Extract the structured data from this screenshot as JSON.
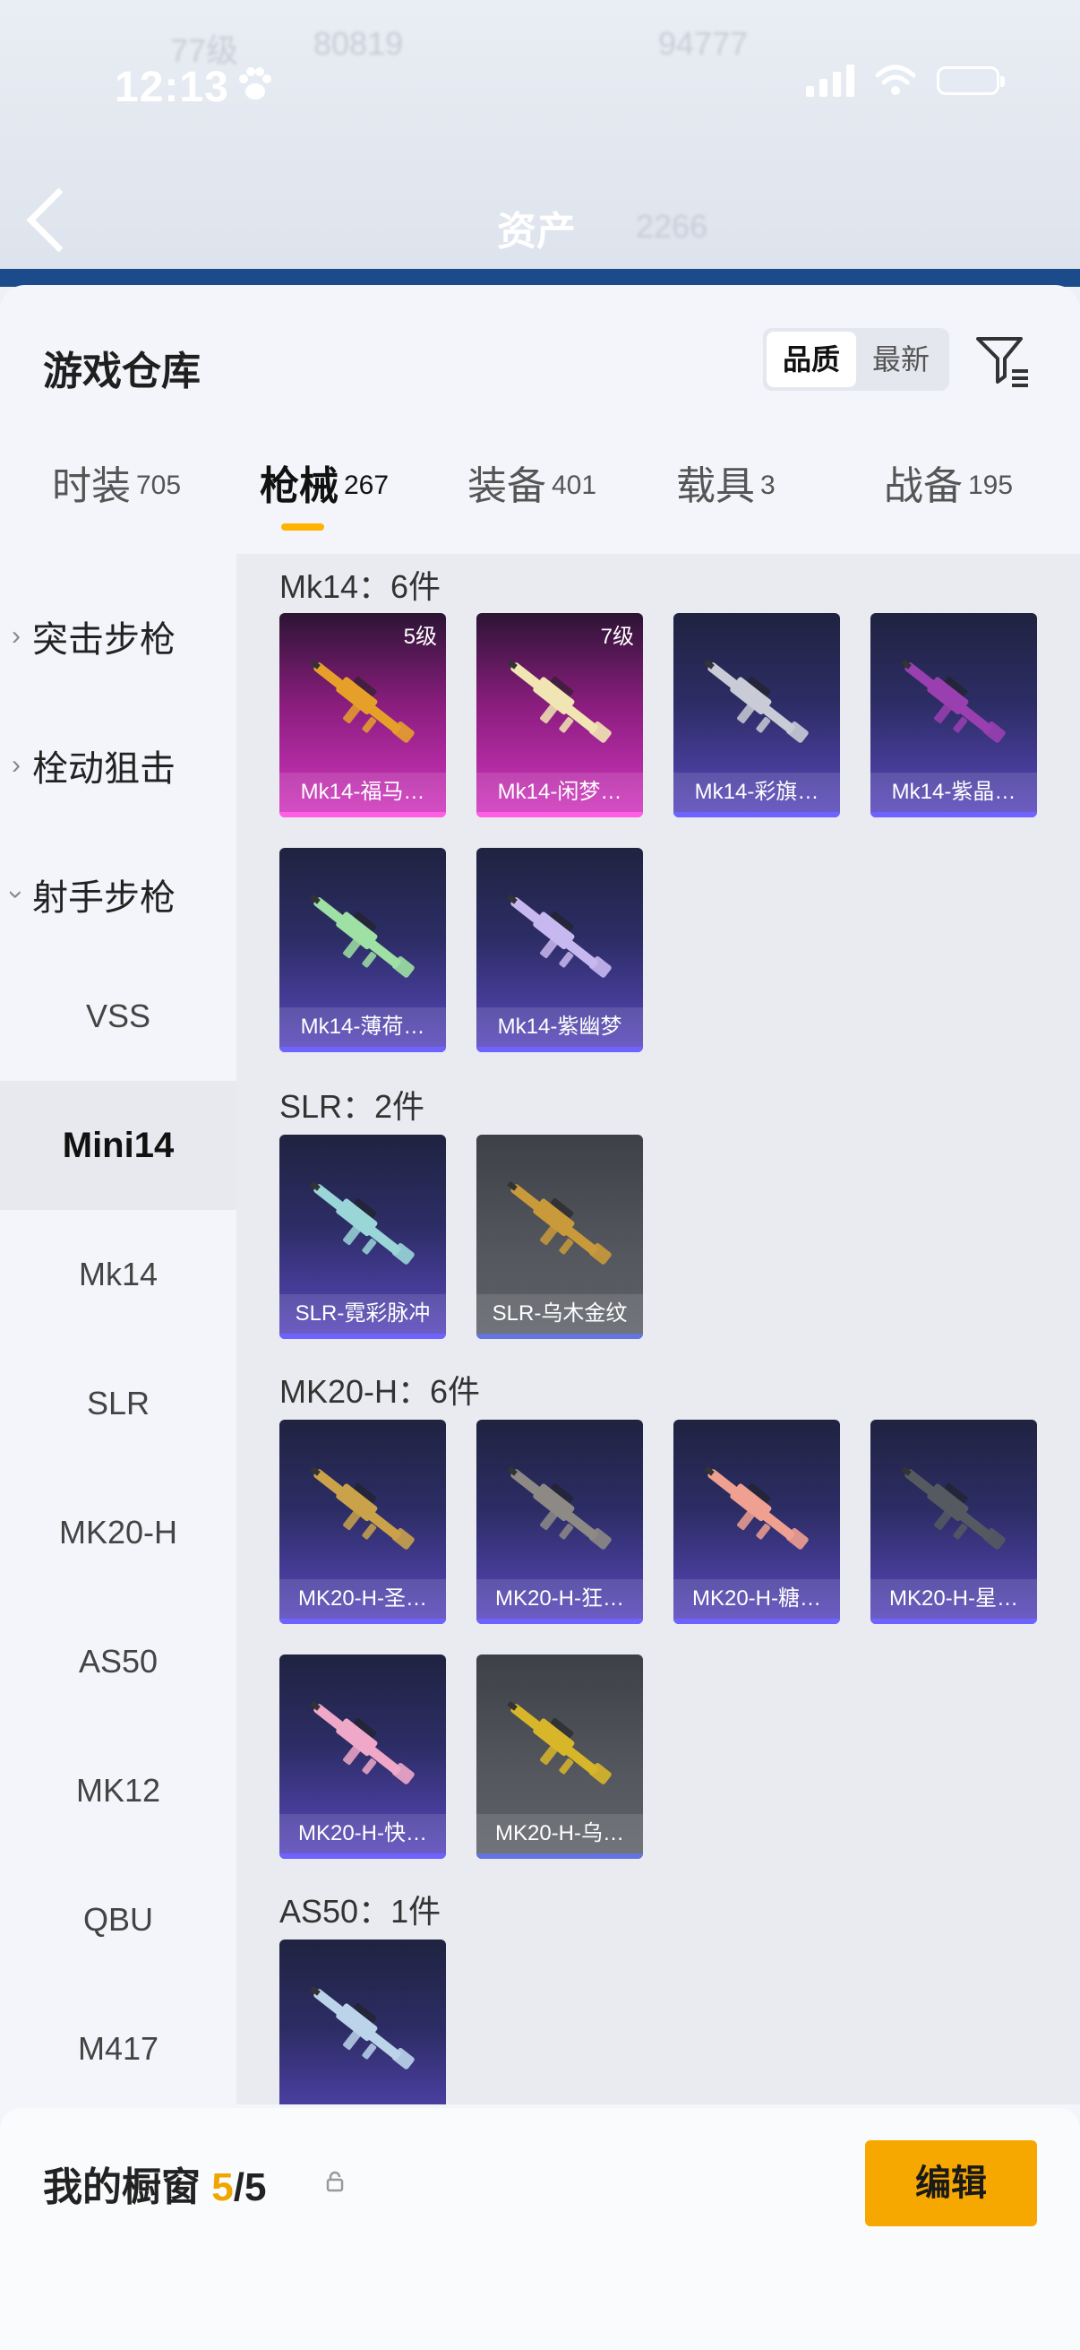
{
  "status_bar": {
    "time": "12:13"
  },
  "background": {
    "title": "资产",
    "ghost_texts": [
      "77级",
      "80819",
      "94777",
      "2266"
    ]
  },
  "sheet": {
    "title": "游戏仓库",
    "sort_options": [
      "品质",
      "最新"
    ],
    "sort_active": "品质"
  },
  "categories": [
    {
      "label": "时装",
      "count": "705"
    },
    {
      "label": "枪械",
      "count": "267"
    },
    {
      "label": "装备",
      "count": "401"
    },
    {
      "label": "载具",
      "count": "3"
    },
    {
      "label": "战备",
      "count": "195"
    }
  ],
  "active_category": "枪械",
  "side_nav": {
    "groups": [
      "突击步枪",
      "栓动狙击",
      "射手步枪"
    ],
    "items": [
      "VSS",
      "Mini14",
      "Mk14",
      "SLR",
      "MK20-H",
      "AS50",
      "MK12",
      "QBU",
      "M417"
    ],
    "active_item": "Mini14"
  },
  "sections": [
    {
      "header": "Mk14：6件",
      "items": [
        {
          "name": "Mk14-福马…",
          "level": "5级",
          "rarity": "pink",
          "gun_color": "#e6a02a"
        },
        {
          "name": "Mk14-闲梦…",
          "level": "7级",
          "rarity": "pink",
          "gun_color": "#f1e6b3"
        },
        {
          "name": "Mk14-彩旗…",
          "level": "",
          "rarity": "purple",
          "gun_color": "#c9ccd6"
        },
        {
          "name": "Mk14-紫晶…",
          "level": "",
          "rarity": "purple",
          "gun_color": "#9a3fb0"
        },
        {
          "name": "Mk14-薄荷…",
          "level": "",
          "rarity": "purple",
          "gun_color": "#9fe0a4"
        },
        {
          "name": "Mk14-紫幽梦",
          "level": "",
          "rarity": "purple",
          "gun_color": "#c8b8f0"
        }
      ]
    },
    {
      "header": "SLR：2件",
      "items": [
        {
          "name": "SLR-霓彩脉冲",
          "level": "",
          "rarity": "purple",
          "gun_color": "#9ad6d8"
        },
        {
          "name": "SLR-乌木金纹",
          "level": "",
          "rarity": "gray",
          "gun_color": "#c99a3a"
        }
      ]
    },
    {
      "header": "MK20-H：6件",
      "items": [
        {
          "name": "MK20-H-圣…",
          "level": "",
          "rarity": "purple",
          "gun_color": "#c9a24a"
        },
        {
          "name": "MK20-H-狂…",
          "level": "",
          "rarity": "purple",
          "gun_color": "#8d8a86"
        },
        {
          "name": "MK20-H-糖…",
          "level": "",
          "rarity": "purple",
          "gun_color": "#f0a090"
        },
        {
          "name": "MK20-H-星…",
          "level": "",
          "rarity": "purple",
          "gun_color": "#555a60"
        },
        {
          "name": "MK20-H-快…",
          "level": "",
          "rarity": "purple",
          "gun_color": "#f0a8c8"
        },
        {
          "name": "MK20-H-乌…",
          "level": "",
          "rarity": "gray",
          "gun_color": "#d8b62a"
        }
      ]
    },
    {
      "header": "AS50：1件",
      "items": [
        {
          "name": "",
          "level": "",
          "rarity": "purple",
          "gun_color": "#bcd4ea"
        }
      ]
    }
  ],
  "showcase": {
    "label": "我的橱窗",
    "current": "5",
    "total": "/5"
  },
  "edit_button": "编辑",
  "colors": {
    "accent": "#f6a800",
    "pink_card": "#d336c0",
    "purple_card": "#5a48bf",
    "gray_card": "#55585f"
  },
  "icons": [
    "paw-icon",
    "back-arrow-icon",
    "filter-icon",
    "share-icon",
    "lock-icon",
    "chevron-right-icon",
    "chevron-down-icon"
  ]
}
